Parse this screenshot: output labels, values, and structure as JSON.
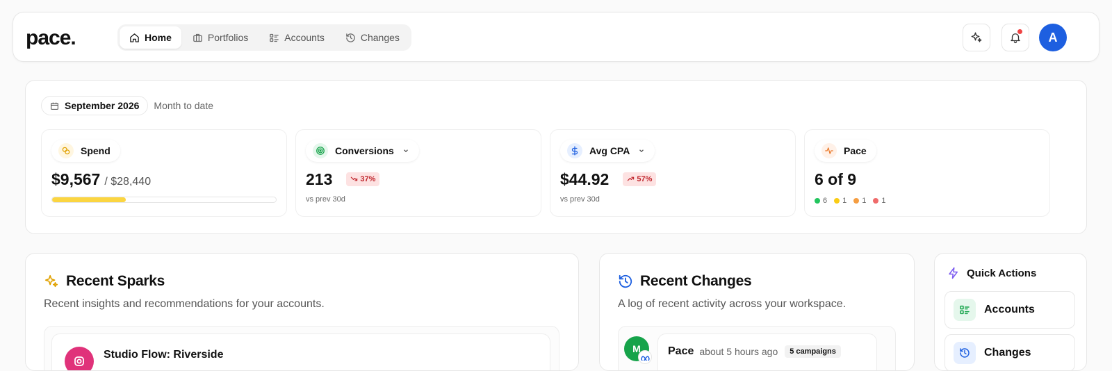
{
  "app": {
    "logo": "pace."
  },
  "nav": {
    "items": [
      {
        "label": "Home",
        "icon": "home-icon",
        "active": true
      },
      {
        "label": "Portfolios",
        "icon": "briefcase-icon"
      },
      {
        "label": "Accounts",
        "icon": "list-icon"
      },
      {
        "label": "Changes",
        "icon": "history-icon"
      }
    ]
  },
  "user": {
    "avatar_initial": "A"
  },
  "period": {
    "month": "September 2026",
    "range": "Month to date"
  },
  "kpis": {
    "spend": {
      "label": "Spend",
      "value": "$9,567",
      "budget": "/ $28,440",
      "progress": 0.33
    },
    "conversions": {
      "label": "Conversions",
      "value": "213",
      "change": "37%",
      "note": "vs prev 30d"
    },
    "cpa": {
      "label": "Avg CPA",
      "value": "$44.92",
      "change": "57%",
      "note": "vs prev 30d"
    },
    "pace": {
      "label": "Pace",
      "value": "6 of 9",
      "counts": [
        "6",
        "1",
        "1",
        "1"
      ]
    }
  },
  "colors": {
    "accent": "#1d5fe0",
    "progress": "#fbd541",
    "green": "#22c55e",
    "yellow": "#facc15",
    "orange": "#f59e42",
    "red": "#ef6b6b"
  },
  "sparks": {
    "title": "Recent Sparks",
    "description": "Recent insights and recommendations for your accounts.",
    "first_item": "Studio Flow: Riverside"
  },
  "changes": {
    "title": "Recent Changes",
    "description": "A log of recent activity across your workspace.",
    "first_item": {
      "author": "Pace",
      "time": "about 5 hours ago",
      "badge": "5 campaigns",
      "avatar": "M"
    }
  },
  "quick_actions": {
    "title": "Quick Actions",
    "items": [
      {
        "label": "Accounts"
      },
      {
        "label": "Changes"
      }
    ]
  }
}
